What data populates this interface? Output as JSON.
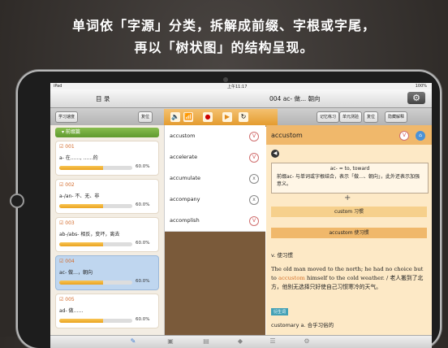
{
  "headline": {
    "line1": "单词依「字源」分类，拆解成前缀、字根或字尾，",
    "line2": "再以「树状图」的结构呈现。"
  },
  "status_bar": {
    "carrier": "iPad",
    "time": "上午11:17",
    "battery": "100%"
  },
  "nav": {
    "left_title": "目 录",
    "right_title": "004 ac- 做... 朝向"
  },
  "toolbar": {
    "study_button": "学习速度",
    "reset_left": "复位",
    "remember": "记忆练习",
    "unit_test": "单元测验",
    "reset_right": "复位",
    "hide_panel": "隐藏解释"
  },
  "sidebar": {
    "section_title": "前缀篇",
    "cards": [
      {
        "number": "001",
        "desc": "a- 在……, ……的",
        "percent": "60.0%",
        "progress": 0.6,
        "selected": false
      },
      {
        "number": "002",
        "desc": "a-/an- 不、无、非",
        "percent": "60.0%",
        "progress": 0.6,
        "selected": false
      },
      {
        "number": "003",
        "desc": "ab-/abs- 相反，变坏，离去",
        "percent": "60.0%",
        "progress": 0.6,
        "selected": false
      },
      {
        "number": "004",
        "desc": "ac- 做…，朝向",
        "percent": "60.0%",
        "progress": 0.6,
        "selected": true
      },
      {
        "number": "005",
        "desc": "ad- 做……",
        "percent": "60.0%",
        "progress": 0.6,
        "selected": false
      }
    ]
  },
  "words": [
    {
      "word": "accustom",
      "icon": "V"
    },
    {
      "word": "accelerate",
      "icon": "V"
    },
    {
      "word": "accumulate",
      "icon": "x"
    },
    {
      "word": "accompany",
      "icon": "x"
    },
    {
      "word": "accomplish",
      "icon": "V"
    }
  ],
  "detail": {
    "word": "accustom",
    "root_line1": "ac- = to, toward",
    "root_line2": "前缀ac- 与单词或字根结合，表示「做…、朝向」，此外还表示加强意义。",
    "plus": "+",
    "part": "custom 习惯",
    "result": "accustom 使习惯",
    "definition": "v. 使习惯",
    "example_pre": "The old man moved to the north; he had no choice but to ",
    "example_hl": "accustom",
    "example_post": " himself to the cold weather. / 老人搬到了北方，他别无选择只好使自己习惯寒冷的天气。",
    "tag": "衍生词",
    "extra": "customary a. 合乎习俗的"
  },
  "colors": {
    "accent": "#f0b86b",
    "progress": "#eaa21f",
    "selected_card": "#bfd6ef",
    "section_green": "#6aa636"
  }
}
